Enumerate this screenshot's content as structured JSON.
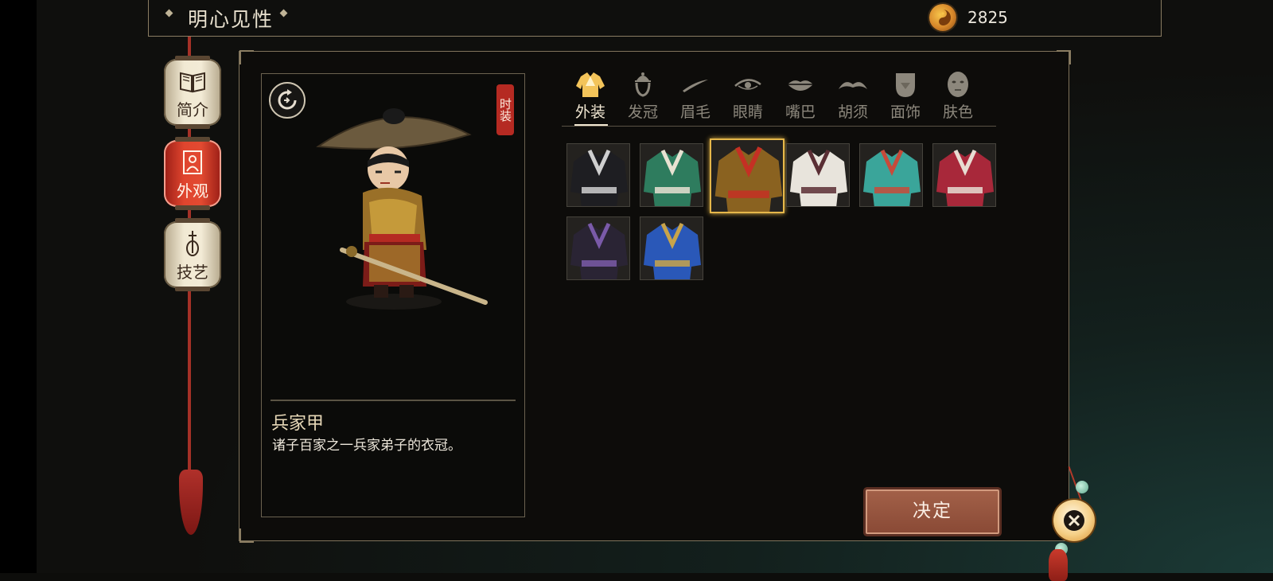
{
  "header": {
    "title": "明心见性",
    "currency_icon": "taiji-coin-icon",
    "currency_value": "2825"
  },
  "nav": [
    {
      "label": "简介",
      "icon": "book-icon",
      "active": false
    },
    {
      "label": "外观",
      "icon": "portrait-icon",
      "active": true
    },
    {
      "label": "技艺",
      "icon": "pipa-icon",
      "active": false
    }
  ],
  "preview": {
    "fashion_tag": "时装",
    "item_name": "兵家甲",
    "item_desc": "诸子百家之一兵家弟子的衣冠。"
  },
  "tabs": [
    {
      "label": "外装",
      "icon": "outfit-icon",
      "active": true
    },
    {
      "label": "发冠",
      "icon": "hair-crown-icon",
      "active": false
    },
    {
      "label": "眉毛",
      "icon": "eyebrow-icon",
      "active": false
    },
    {
      "label": "眼睛",
      "icon": "eye-icon",
      "active": false
    },
    {
      "label": "嘴巴",
      "icon": "mouth-icon",
      "active": false
    },
    {
      "label": "胡须",
      "icon": "mustache-icon",
      "active": false
    },
    {
      "label": "面饰",
      "icon": "face-ornament-icon",
      "active": false
    },
    {
      "label": "肤色",
      "icon": "skin-tone-icon",
      "active": false
    }
  ],
  "outfits": [
    {
      "id": "black-robe",
      "color": "#1e1e22",
      "trim": "#cfcfcf",
      "selected": false
    },
    {
      "id": "green-robe",
      "color": "#2e7c5e",
      "trim": "#e8e2d2",
      "selected": false
    },
    {
      "id": "bingjia-armor",
      "color": "#8a6220",
      "trim": "#c43024",
      "selected": true
    },
    {
      "id": "white-robe",
      "color": "#e8e4dc",
      "trim": "#5a2e34",
      "selected": false
    },
    {
      "id": "teal-robe",
      "color": "#3aa59a",
      "trim": "#c84a3a",
      "selected": false
    },
    {
      "id": "red-robe",
      "color": "#a8283a",
      "trim": "#e8dcd2",
      "selected": false
    },
    {
      "id": "purple-robe",
      "color": "#2a2434",
      "trim": "#7a5aa8",
      "selected": false
    },
    {
      "id": "blue-robe",
      "color": "#2a58b8",
      "trim": "#c8a44a",
      "selected": false
    }
  ],
  "confirm_label": "决定",
  "close_icon": "close-icon",
  "colors": {
    "accent_gold": "#e5b74a",
    "nav_active": "#e0452e",
    "confirm": "#8a4a36"
  }
}
